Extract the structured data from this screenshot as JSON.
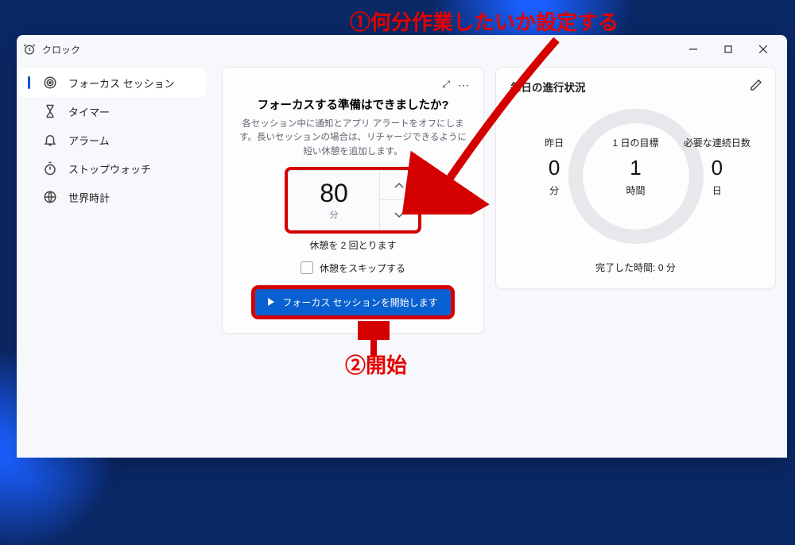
{
  "window": {
    "title": "クロック"
  },
  "sidebar": {
    "items": [
      {
        "label": "フォーカス セッション"
      },
      {
        "label": "タイマー"
      },
      {
        "label": "アラーム"
      },
      {
        "label": "ストップウォッチ"
      },
      {
        "label": "世界時計"
      }
    ]
  },
  "focus": {
    "title": "フォーカスする準備はできましたか?",
    "description": "各セッション中に通知とアプリ アラートをオフにします。長いセッションの場合は、リチャージできるように短い休憩を追加します。",
    "duration_value": "80",
    "duration_unit": "分",
    "breaks_text": "休憩を 2 回とります",
    "skip_label": "休憩をスキップする",
    "start_label": "フォーカス セッションを開始します"
  },
  "progress": {
    "title": "毎日の進行状況",
    "stats": [
      {
        "label": "昨日",
        "value": "0",
        "unit": "分"
      },
      {
        "label": "1 日の目標",
        "value": "1",
        "unit": "時間"
      },
      {
        "label": "必要な連続日数",
        "value": "0",
        "unit": "日"
      }
    ],
    "completed": "完了した時間: 0 分"
  },
  "annotations": {
    "a1": "①何分作業したいか設定する",
    "a2": "②開始"
  }
}
